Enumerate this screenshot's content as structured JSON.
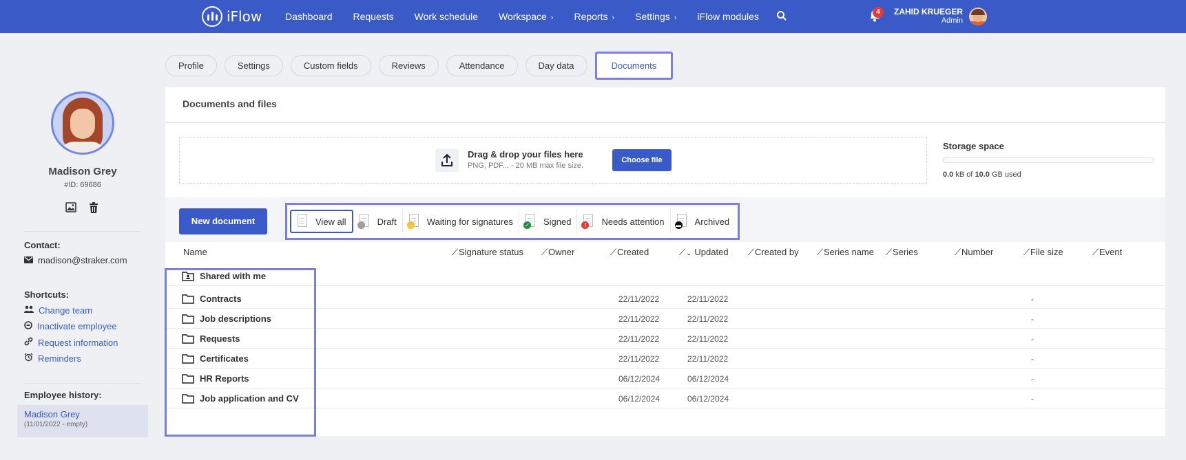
{
  "app": {
    "logo_text": "iFlow",
    "nav": [
      {
        "label": "Dashboard",
        "has_submenu": false
      },
      {
        "label": "Requests",
        "has_submenu": false
      },
      {
        "label": "Work schedule",
        "has_submenu": false
      },
      {
        "label": "Workspace",
        "has_submenu": true
      },
      {
        "label": "Reports",
        "has_submenu": true
      },
      {
        "label": "Settings",
        "has_submenu": true
      },
      {
        "label": "iFlow modules",
        "has_submenu": false
      }
    ],
    "notifications_count": "4",
    "user_name": "ZAHID KRUEGER",
    "user_role": "Admin"
  },
  "employee": {
    "name": "Madison Grey",
    "id": "#ID: 69686",
    "contact_title": "Contact:",
    "email": "madison@straker.com",
    "shortcuts_title": "Shortcuts:",
    "shortcuts": [
      {
        "label": "Change team",
        "icon": "users-icon"
      },
      {
        "label": "Inactivate employee",
        "icon": "inactivate-icon"
      },
      {
        "label": "Request information",
        "icon": "link-icon"
      },
      {
        "label": "Reminders",
        "icon": "alarm-icon"
      }
    ],
    "history_title": "Employee history:",
    "history_name": "Madison Grey",
    "history_dates": "(11/01/2022 - empty)"
  },
  "tabs": [
    {
      "label": "Profile",
      "active": false
    },
    {
      "label": "Settings",
      "active": false
    },
    {
      "label": "Custom fields",
      "active": false
    },
    {
      "label": "Reviews",
      "active": false
    },
    {
      "label": "Attendance",
      "active": false
    },
    {
      "label": "Day data",
      "active": false
    },
    {
      "label": "Documents",
      "active": true
    }
  ],
  "documents": {
    "title": "Documents and files",
    "dropzone_title": "Drag & drop your files here",
    "dropzone_hint": "PNG, PDF... - 20 MB max file size.",
    "choose_file": "Choose file",
    "storage_title": "Storage space",
    "storage_used_value": "0.0",
    "storage_used_mid": " kB of ",
    "storage_total_value": "10.0",
    "storage_used_tail": " GB used",
    "storage_fraction": 0.0,
    "new_document": "New document",
    "filters": [
      {
        "label": "View all",
        "active": true,
        "dot_color": "",
        "dot_glyph": ""
      },
      {
        "label": "Draft",
        "active": false,
        "dot_color": "#9e9e9e",
        "dot_glyph": ""
      },
      {
        "label": "Waiting for signatures",
        "active": false,
        "dot_color": "#f2c12e",
        "dot_glyph": "→"
      },
      {
        "label": "Signed",
        "active": false,
        "dot_color": "#2e8b3e",
        "dot_glyph": "✓"
      },
      {
        "label": "Needs attention",
        "active": false,
        "dot_color": "#e53935",
        "dot_glyph": "!"
      },
      {
        "label": "Archived",
        "active": false,
        "dot_color": "#111111",
        "dot_glyph": "▬"
      }
    ],
    "columns": [
      "Name",
      "Signature status",
      "Owner",
      "Created",
      "Updated",
      "Created by",
      "Series name",
      "Series",
      "Number",
      "File size",
      "Event"
    ],
    "sorted_column": "Updated",
    "rows": [
      {
        "name": "Shared with me",
        "icon": "shared-folder-icon",
        "created": "",
        "updated": "",
        "file_size": ""
      },
      {
        "name": "Contracts",
        "icon": "folder-icon",
        "created": "22/11/2022",
        "updated": "22/11/2022",
        "file_size": "-"
      },
      {
        "name": "Job descriptions",
        "icon": "folder-icon",
        "created": "22/11/2022",
        "updated": "22/11/2022",
        "file_size": "-"
      },
      {
        "name": "Requests",
        "icon": "folder-icon",
        "created": "22/11/2022",
        "updated": "22/11/2022",
        "file_size": "-"
      },
      {
        "name": "Certificates",
        "icon": "folder-icon",
        "created": "22/11/2022",
        "updated": "22/11/2022",
        "file_size": "-"
      },
      {
        "name": "HR Reports",
        "icon": "folder-icon",
        "created": "06/12/2024",
        "updated": "06/12/2024",
        "file_size": "-"
      },
      {
        "name": "Job application and CV",
        "icon": "folder-icon",
        "created": "06/12/2024",
        "updated": "06/12/2024",
        "file_size": "-"
      }
    ]
  },
  "colors": {
    "brand": "#3a5bc7",
    "highlight": "#7b7fe0",
    "background": "#eef0f4"
  }
}
